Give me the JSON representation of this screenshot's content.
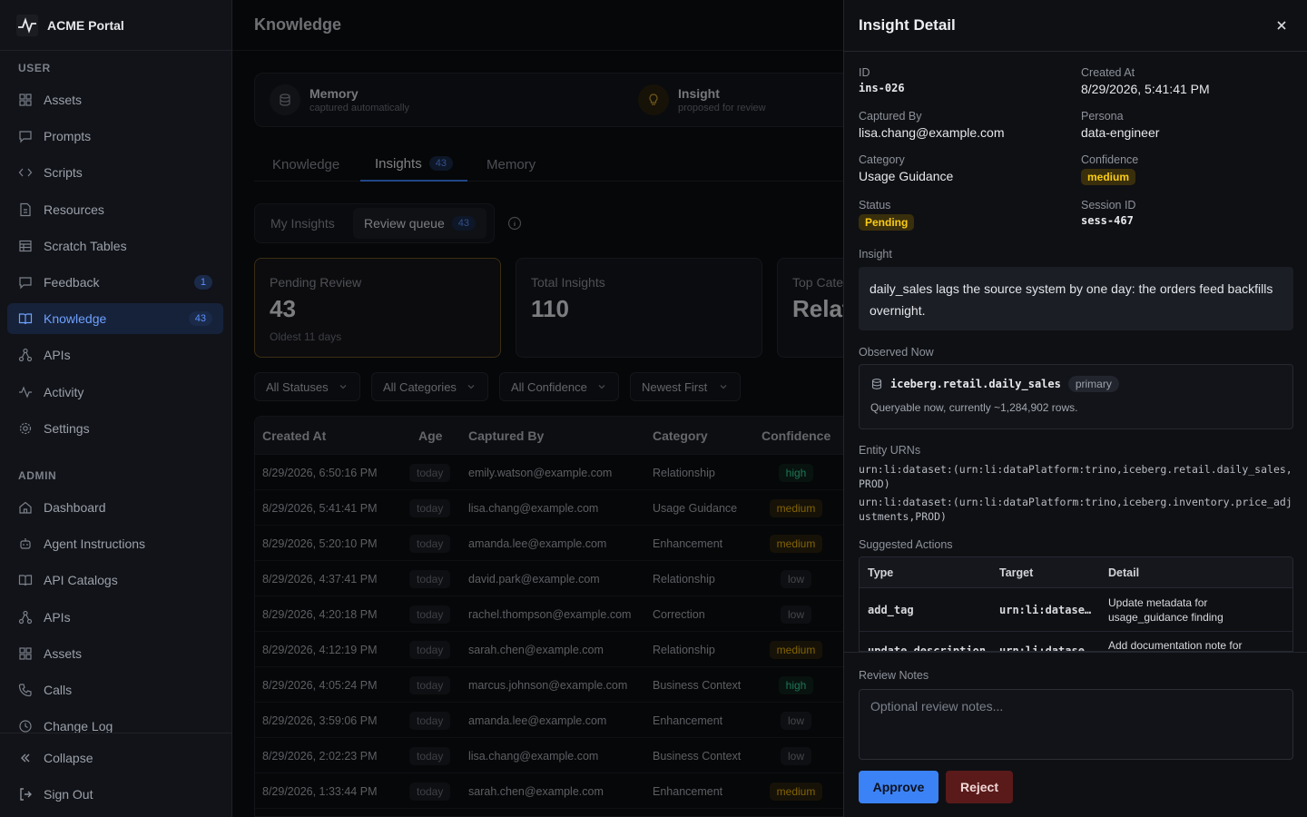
{
  "app": {
    "name": "ACME Portal"
  },
  "sidebar": {
    "user_section": "USER",
    "admin_section": "ADMIN",
    "user_items": [
      {
        "label": "Assets",
        "icon": "grid-icon"
      },
      {
        "label": "Prompts",
        "icon": "message-icon"
      },
      {
        "label": "Scripts",
        "icon": "code-icon"
      },
      {
        "label": "Resources",
        "icon": "file-icon"
      },
      {
        "label": "Scratch Tables",
        "icon": "table-icon"
      },
      {
        "label": "Feedback",
        "icon": "message-icon",
        "badge": "1"
      },
      {
        "label": "Knowledge",
        "icon": "book-icon",
        "badge": "43",
        "active": true
      },
      {
        "label": "APIs",
        "icon": "network-icon"
      },
      {
        "label": "Activity",
        "icon": "activity-icon"
      },
      {
        "label": "Settings",
        "icon": "gear-icon"
      }
    ],
    "admin_items": [
      {
        "label": "Dashboard",
        "icon": "home-icon"
      },
      {
        "label": "Agent Instructions",
        "icon": "bot-icon"
      },
      {
        "label": "API Catalogs",
        "icon": "book-icon"
      },
      {
        "label": "APIs",
        "icon": "network-icon"
      },
      {
        "label": "Assets",
        "icon": "grid-icon"
      },
      {
        "label": "Calls",
        "icon": "phone-icon"
      },
      {
        "label": "Change Log",
        "icon": "clock-icon"
      }
    ],
    "collapse": "Collapse",
    "sign_out": "Sign Out"
  },
  "header": {
    "title": "Knowledge"
  },
  "types": {
    "memory_title": "Memory",
    "memory_sub": "captured automatically",
    "insight_title": "Insight",
    "insight_sub": "proposed for review"
  },
  "tabs": [
    {
      "label": "Knowledge"
    },
    {
      "label": "Insights",
      "count": "43",
      "active": true
    },
    {
      "label": "Memory"
    }
  ],
  "segments": {
    "my": "My Insights",
    "queue": "Review queue",
    "queue_count": "43"
  },
  "stats": [
    {
      "label": "Pending Review",
      "value": "43",
      "sub": "Oldest 11 days"
    },
    {
      "label": "Total Insights",
      "value": "110",
      "sub": ""
    },
    {
      "label": "Top Cate",
      "value": "Relat",
      "sub": ""
    }
  ],
  "filters": [
    "All Statuses",
    "All Categories",
    "All Confidence",
    "Newest First"
  ],
  "table": {
    "headers": [
      "Created At",
      "Age",
      "Captured By",
      "Category",
      "Confidence"
    ],
    "rows": [
      [
        "8/29/2026, 6:50:16 PM",
        "today",
        "emily.watson@example.com",
        "Relationship",
        "high"
      ],
      [
        "8/29/2026, 5:41:41 PM",
        "today",
        "lisa.chang@example.com",
        "Usage Guidance",
        "medium"
      ],
      [
        "8/29/2026, 5:20:10 PM",
        "today",
        "amanda.lee@example.com",
        "Enhancement",
        "medium"
      ],
      [
        "8/29/2026, 4:37:41 PM",
        "today",
        "david.park@example.com",
        "Relationship",
        "low"
      ],
      [
        "8/29/2026, 4:20:18 PM",
        "today",
        "rachel.thompson@example.com",
        "Correction",
        "low"
      ],
      [
        "8/29/2026, 4:12:19 PM",
        "today",
        "sarah.chen@example.com",
        "Relationship",
        "medium"
      ],
      [
        "8/29/2026, 4:05:24 PM",
        "today",
        "marcus.johnson@example.com",
        "Business Context",
        "high"
      ],
      [
        "8/29/2026, 3:59:06 PM",
        "today",
        "amanda.lee@example.com",
        "Enhancement",
        "low"
      ],
      [
        "8/29/2026, 2:02:23 PM",
        "today",
        "lisa.chang@example.com",
        "Business Context",
        "low"
      ],
      [
        "8/29/2026, 1:33:44 PM",
        "today",
        "sarah.chen@example.com",
        "Enhancement",
        "medium"
      ]
    ]
  },
  "detail": {
    "title": "Insight Detail",
    "id_label": "ID",
    "id": "ins-026",
    "created_label": "Created At",
    "created": "8/29/2026, 5:41:41 PM",
    "captured_label": "Captured By",
    "captured": "lisa.chang@example.com",
    "persona_label": "Persona",
    "persona": "data-engineer",
    "category_label": "Category",
    "category": "Usage Guidance",
    "confidence_label": "Confidence",
    "confidence": "medium",
    "status_label": "Status",
    "status": "Pending",
    "session_label": "Session ID",
    "session": "sess-467",
    "insight_label": "Insight",
    "insight": "daily_sales lags the source system by one day: the orders feed backfills overnight.",
    "observed_label": "Observed Now",
    "observed_table": "iceberg.retail.daily_sales",
    "observed_tag": "primary",
    "observed_desc": "Queryable now, currently ~1,284,902 rows.",
    "urns_label": "Entity URNs",
    "urns": [
      "urn:li:dataset:(urn:li:dataPlatform:trino,iceberg.retail.daily_sales,PROD)",
      "urn:li:dataset:(urn:li:dataPlatform:trino,iceberg.inventory.price_adjustments,PROD)"
    ],
    "actions_label": "Suggested Actions",
    "actions_headers": [
      "Type",
      "Target",
      "Detail"
    ],
    "actions": [
      {
        "type": "add_tag",
        "target": "urn:li:datase…",
        "detail": "Update metadata for usage_guidance finding"
      },
      {
        "type": "update_description",
        "target": "urn:li:datase…",
        "detail": "Add documentation note for"
      }
    ],
    "notes_label": "Review Notes",
    "notes_placeholder": "Optional review notes...",
    "approve": "Approve",
    "reject": "Reject"
  },
  "colors": {
    "accent": "#3b82f6",
    "reject": "#5a1a1a",
    "warning": "#eab308",
    "success": "#34d399"
  }
}
